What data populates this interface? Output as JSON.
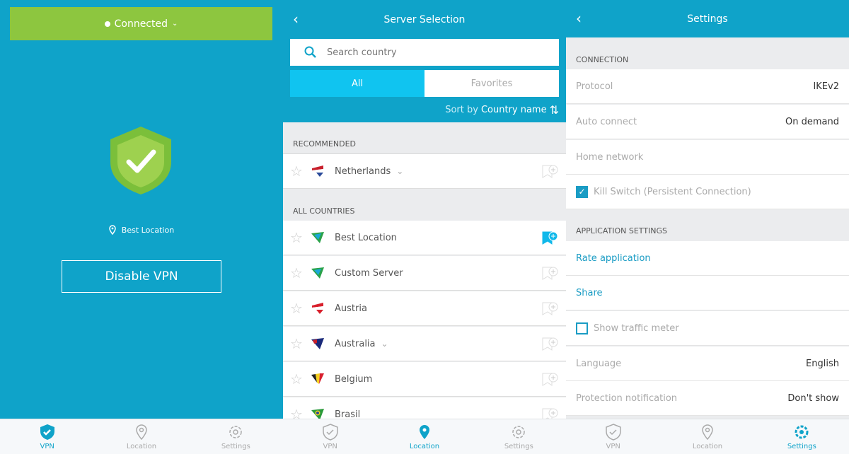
{
  "colors": {
    "brand": "#0fa3c9",
    "connected": "#8dc63f",
    "selected_tab": "#10c4f0"
  },
  "tabbar": {
    "vpn": "VPN",
    "location": "Location",
    "settings": "Settings"
  },
  "vpn": {
    "status": "Connected",
    "location": "Best Location",
    "disable_button": "Disable VPN"
  },
  "servers": {
    "title": "Server Selection",
    "search_placeholder": "Search country",
    "tabs": [
      "All",
      "Favorites"
    ],
    "sort_label": "Sort by",
    "sort_value": "Country name",
    "recommended_header": "RECOMMENDED",
    "recommended": [
      {
        "name": "Netherlands",
        "expandable": true,
        "flag": "netherlands"
      }
    ],
    "all_header": "ALL COUNTRIES",
    "countries": [
      {
        "name": "Best Location",
        "expandable": false,
        "flag": "best",
        "favorited": true
      },
      {
        "name": "Custom Server",
        "expandable": false,
        "flag": "best",
        "favorited": false
      },
      {
        "name": "Austria",
        "expandable": false,
        "flag": "austria",
        "favorited": false
      },
      {
        "name": "Australia",
        "expandable": true,
        "flag": "australia",
        "favorited": false
      },
      {
        "name": "Belgium",
        "expandable": false,
        "flag": "belgium",
        "favorited": false
      },
      {
        "name": "Brasil",
        "expandable": false,
        "flag": "brasil",
        "favorited": false
      }
    ]
  },
  "settings": {
    "title": "Settings",
    "connection_header": "CONNECTION",
    "protocol": {
      "label": "Protocol",
      "value": "IKEv2"
    },
    "auto_connect": {
      "label": "Auto connect",
      "value": "On demand"
    },
    "home_network": {
      "label": "Home network"
    },
    "kill_switch": {
      "label": "Kill Switch (Persistent Connection)",
      "checked": true
    },
    "app_header": "APPLICATION SETTINGS",
    "rate": "Rate application",
    "share": "Share",
    "traffic_meter": {
      "label": "Show traffic meter",
      "checked": false
    },
    "language": {
      "label": "Language",
      "value": "English"
    },
    "protection_notification": {
      "label": "Protection notification",
      "value": "Don't show"
    }
  }
}
